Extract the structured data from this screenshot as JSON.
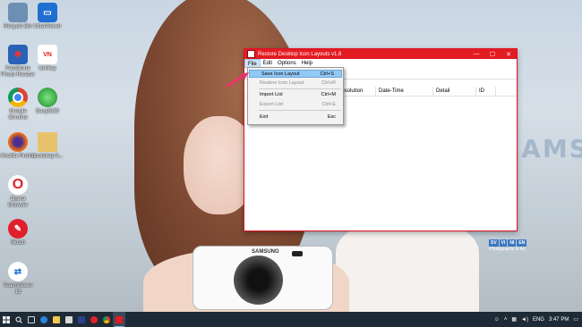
{
  "desktop": {
    "icons": [
      {
        "label": "Recycle Bin",
        "color": "#6c8fb3",
        "glyph": "🗑"
      },
      {
        "label": "UltraViewer",
        "color": "#1f6fd1",
        "glyph": "▭"
      },
      {
        "label": "FastStone Photo Resizer",
        "color": "#2a62b8",
        "glyph": "✱"
      },
      {
        "label": "UniKey",
        "color": "#ffffff",
        "glyph": "VN"
      },
      {
        "label": "Google Chrome",
        "color": "#e9e9e9",
        "glyph": "◉"
      },
      {
        "label": "EasyBCD",
        "color": "#2f9e3e",
        "glyph": "●"
      },
      {
        "label": "Mozilla Firefox",
        "color": "#e26a1b",
        "glyph": "◍"
      },
      {
        "label": "bootstrap li...",
        "color": "#e7c26a",
        "glyph": "▤"
      },
      {
        "label": "Opera Browser",
        "color": "#e0202c",
        "glyph": "O"
      },
      {
        "label": "Skitch",
        "color": "#e0202c",
        "glyph": "✎"
      },
      {
        "label": "TeamViewer 13",
        "color": "#1a6ed8",
        "glyph": "⇄"
      }
    ],
    "camera_brand": "SAMSUNG",
    "watermark_text": "SAMSUNG",
    "logo_badge": [
      "SV",
      "VI",
      "NI",
      "EN",
      "Photography & Art"
    ]
  },
  "window": {
    "title": "Restore Desktop Icon Layouts v1.8",
    "controls": {
      "minimize": "—",
      "maximize": "☐",
      "close": "✕"
    },
    "menu": [
      "File",
      "Edit",
      "Options",
      "Help"
    ],
    "columns": [
      "Resolution",
      "Date-Time",
      "Detail",
      "ID"
    ]
  },
  "file_menu": {
    "items": [
      {
        "label": "Save Icon Layout",
        "shortcut": "Ctrl+S",
        "state": "highlighted"
      },
      {
        "label": "Restore Icon Layout",
        "shortcut": "Ctrl+R",
        "state": "disabled"
      },
      {
        "label": "Import List",
        "shortcut": "Ctrl+M",
        "state": "normal"
      },
      {
        "label": "Export List",
        "shortcut": "Ctrl+E",
        "state": "disabled"
      },
      {
        "label": "Exit",
        "shortcut": "Esc",
        "state": "normal"
      }
    ]
  },
  "taskbar": {
    "start_icon": "windows-start-icon",
    "apps": [
      {
        "name": "task-view",
        "color": "#cfd8e0"
      },
      {
        "name": "edge",
        "color": "#2b84d8"
      },
      {
        "name": "file-explorer",
        "color": "#f2c94c"
      },
      {
        "name": "store",
        "color": "#d8d8d8"
      },
      {
        "name": "photoshop",
        "color": "#2a3f8f"
      },
      {
        "name": "opera",
        "color": "#e0202c"
      },
      {
        "name": "chrome",
        "color": "#3aa757"
      },
      {
        "name": "restore-desktop-icon-layouts",
        "color": "#e31b23"
      }
    ],
    "tray": {
      "language": "ENG",
      "time": "3:47 PM"
    }
  }
}
